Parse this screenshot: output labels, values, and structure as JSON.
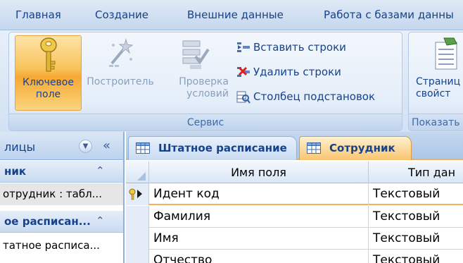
{
  "ribbon": {
    "tabs": [
      "Главная",
      "Создание",
      "Внешние данные",
      "Работа с базами данны"
    ],
    "groups": {
      "service": {
        "label": "Сервис",
        "key_field": {
          "line1": "Ключевое",
          "line2": "поле"
        },
        "builder": {
          "line1": "Построитель"
        },
        "check": {
          "line1": "Проверка",
          "line2": "условий"
        },
        "insert_rows": "Вставить строки",
        "delete_rows": "Удалить строки",
        "lookup_column": "Столбец  подстановок"
      },
      "show": {
        "label": "Показать",
        "property_sheet": {
          "line1": "Страниц",
          "line2": "свойст"
        }
      }
    }
  },
  "nav_pane": {
    "title": "лицы",
    "groups": [
      {
        "label": "ник",
        "items": [
          "отрудник : табл..."
        ]
      },
      {
        "label": "ое расписан...",
        "items": [
          "татное расписа..."
        ]
      }
    ]
  },
  "doc_tabs": [
    "Штатное расписание",
    "Сотрудник"
  ],
  "grid": {
    "headers": [
      "Имя поля",
      "Тип дан"
    ],
    "rows": [
      {
        "field": "Идент код",
        "type": "Текстовый"
      },
      {
        "field": "Фамилия",
        "type": "Текстовый"
      },
      {
        "field": "Имя",
        "type": "Текстовый"
      },
      {
        "field": "Отчество",
        "type": "Текстовый"
      }
    ]
  },
  "colors": {
    "accent_orange": "#f6a832",
    "ribbon_blue": "#c5d7ee",
    "text_blue": "#15428b"
  },
  "icons": {
    "key_field": "key-icon",
    "builder": "wand-icon",
    "check": "check-rules-icon",
    "insert_rows": "insert-rows-icon",
    "delete_rows": "delete-rows-icon",
    "lookup_column": "lookup-column-icon",
    "property_sheet": "property-sheet-icon",
    "table_tab": "table-icon",
    "primary_key_row": "primary-key-icon"
  }
}
